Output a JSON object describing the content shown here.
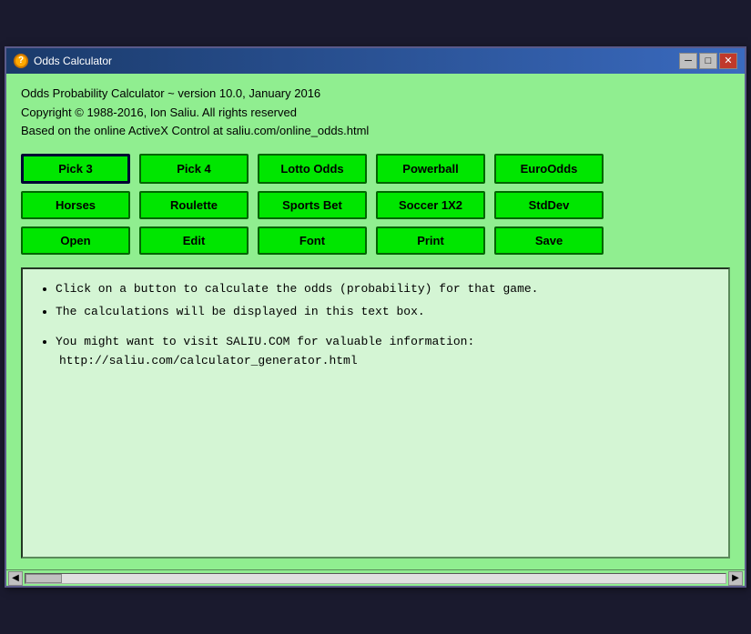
{
  "window": {
    "title": "Odds Calculator",
    "icon_label": "?"
  },
  "title_buttons": {
    "minimize": "─",
    "maximize": "□",
    "close": "✕"
  },
  "header": {
    "line1": "Odds Probability Calculator ~ version 10.0, January 2016",
    "line2": "Copyright © 1988-2016, Ion Saliu. All rights reserved",
    "line3": "Based on the online ActiveX Control at saliu.com/online_odds.html"
  },
  "buttons": {
    "row1": [
      {
        "label": "Pick 3",
        "active": true
      },
      {
        "label": "Pick 4",
        "active": false
      },
      {
        "label": "Lotto Odds",
        "active": false
      },
      {
        "label": "Powerball",
        "active": false
      },
      {
        "label": "EuroOdds",
        "active": false
      }
    ],
    "row2": [
      {
        "label": "Horses",
        "active": false
      },
      {
        "label": "Roulette",
        "active": false
      },
      {
        "label": "Sports Bet",
        "active": false
      },
      {
        "label": "Soccer 1X2",
        "active": false
      },
      {
        "label": "StdDev",
        "active": false
      }
    ],
    "row3": [
      {
        "label": "Open",
        "active": false
      },
      {
        "label": "Edit",
        "active": false
      },
      {
        "label": "Font",
        "active": false
      },
      {
        "label": "Print",
        "active": false
      },
      {
        "label": "Save",
        "active": false
      }
    ]
  },
  "output": {
    "bullet1": "Click on a button to calculate the odds (probability) for that game.",
    "bullet2": "The calculations will be displayed in this text box.",
    "bullet3": "You might want to visit SALIU.COM for valuable information:",
    "url": "http://saliu.com/calculator_generator.html"
  }
}
